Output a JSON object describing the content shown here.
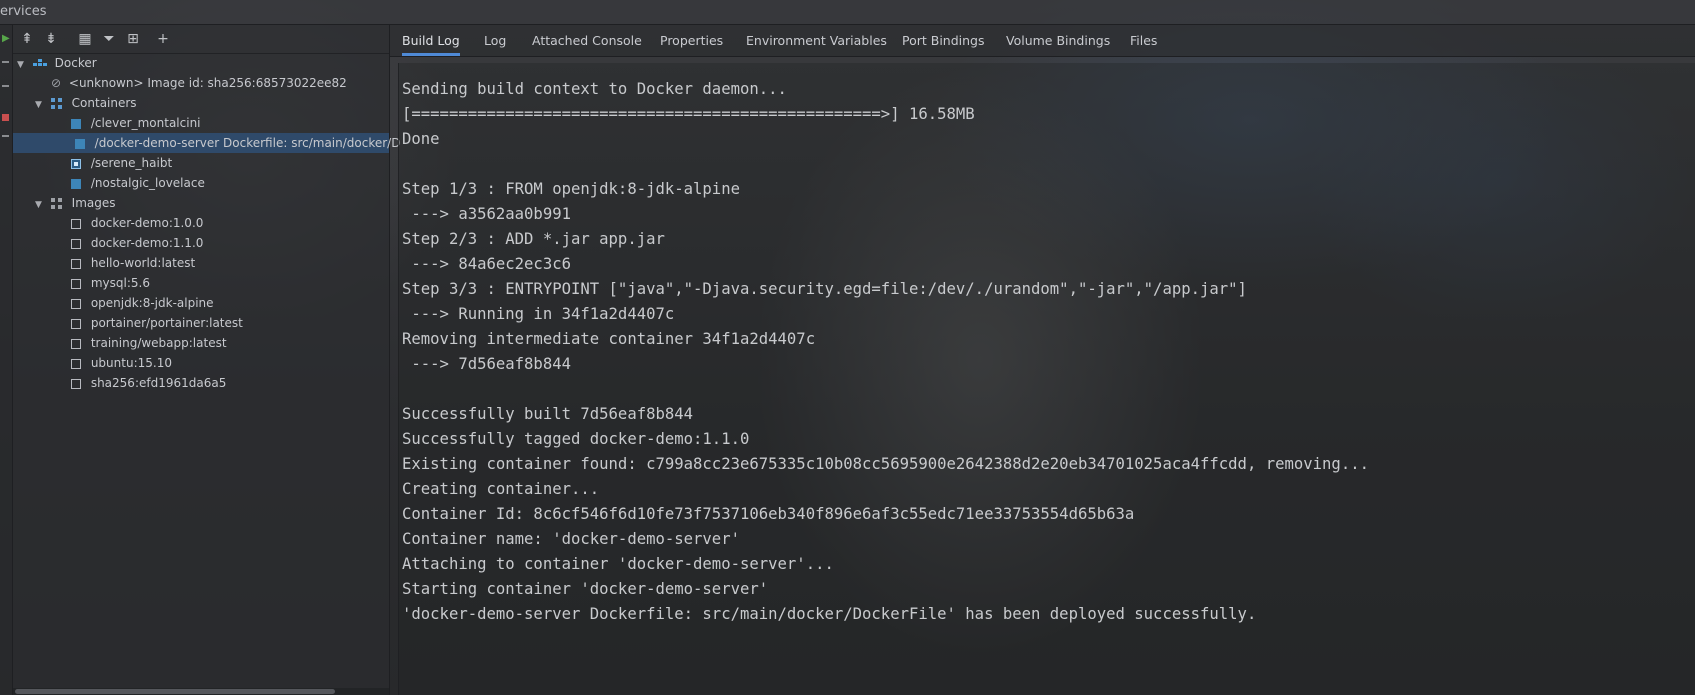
{
  "window": {
    "title": "ervices"
  },
  "toolbar": {
    "buttons": [
      {
        "icon": "expand-all-icon",
        "glyph": "⇞"
      },
      {
        "icon": "collapse-all-icon",
        "glyph": "⇟"
      },
      {
        "icon": "group-icon",
        "glyph": "▦"
      },
      {
        "icon": "filter-icon",
        "glyph": "⏷"
      },
      {
        "icon": "new-window-icon",
        "glyph": "⊞"
      },
      {
        "icon": "add-icon",
        "glyph": "+"
      }
    ]
  },
  "tree": {
    "root": {
      "label": "Docker"
    },
    "unknown": {
      "label": "<unknown>  Image id: sha256:68573022ee82"
    },
    "containers": {
      "label": "Containers",
      "items": [
        {
          "label": "/clever_montalcini",
          "state": "running"
        },
        {
          "label": "/docker-demo-server Dockerfile: src/main/docker/D",
          "state": "running",
          "selected": true
        },
        {
          "label": "/serene_haibt",
          "state": "stopped"
        },
        {
          "label": "/nostalgic_lovelace",
          "state": "running"
        }
      ]
    },
    "images": {
      "label": "Images",
      "items": [
        "docker-demo:1.0.0",
        "docker-demo:1.1.0",
        "hello-world:latest",
        "mysql:5.6",
        "openjdk:8-jdk-alpine",
        "portainer/portainer:latest",
        "training/webapp:latest",
        "ubuntu:15.10",
        "sha256:efd1961da6a5"
      ]
    }
  },
  "tabs": [
    {
      "label": "Build Log",
      "active": true
    },
    {
      "label": "Log"
    },
    {
      "label": "Attached Console"
    },
    {
      "label": "Properties"
    },
    {
      "label": "Environment Variables"
    },
    {
      "label": "Port Bindings"
    },
    {
      "label": "Volume Bindings"
    },
    {
      "label": "Files"
    }
  ],
  "build_log": [
    "Sending build context to Docker daemon...",
    "[==================================================>] 16.58MB",
    "Done",
    "",
    "Step 1/3 : FROM openjdk:8-jdk-alpine",
    " ---> a3562aa0b991",
    "Step 2/3 : ADD *.jar app.jar",
    " ---> 84a6ec2ec3c6",
    "Step 3/3 : ENTRYPOINT [\"java\",\"-Djava.security.egd=file:/dev/./urandom\",\"-jar\",\"/app.jar\"]",
    " ---> Running in 34f1a2d4407c",
    "Removing intermediate container 34f1a2d4407c",
    " ---> 7d56eaf8b844",
    "",
    "Successfully built 7d56eaf8b844",
    "Successfully tagged docker-demo:1.1.0",
    "Existing container found: c799a8cc23e675335c10b08cc5695900e2642388d2e20eb34701025aca4ffcdd, removing...",
    "Creating container...",
    "Container Id: 8c6cf546f6d10fe73f7537106eb340f896e6af3c55edc71ee33753554d65b63a",
    "Container name: 'docker-demo-server'",
    "Attaching to container 'docker-demo-server'...",
    "Starting container 'docker-demo-server'",
    "'docker-demo-server Dockerfile: src/main/docker/DockerFile' has been deployed successfully."
  ],
  "colors": {
    "accent": "#4f8ad6",
    "selection": "#2f4a6a",
    "running": "#3d85b8"
  }
}
